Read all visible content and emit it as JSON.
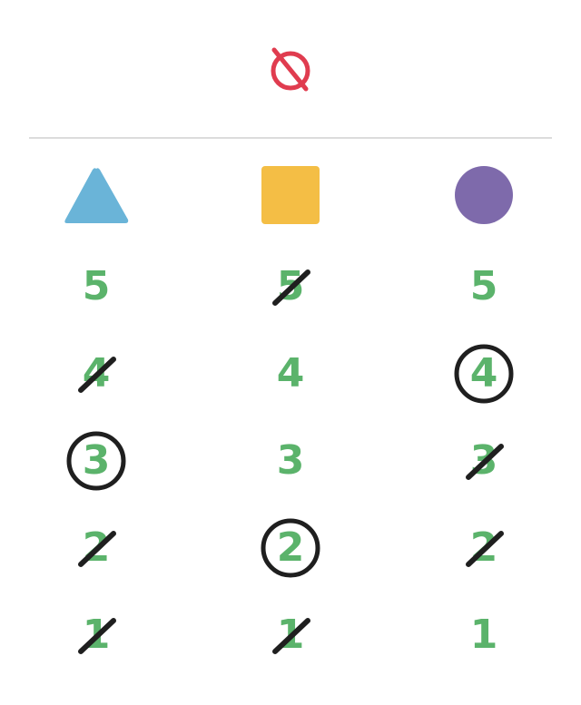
{
  "header": {
    "icon": "prohibited-icon",
    "icon_color": "#e03c4f"
  },
  "colors": {
    "number": "#5bb36b",
    "mark": "#1f1f1f",
    "divider": "#dcdcdc"
  },
  "columns": [
    {
      "shape": "triangle",
      "shape_color": "#6ab4d8",
      "numbers": [
        {
          "value": "5",
          "state": "plain"
        },
        {
          "value": "4",
          "state": "crossed"
        },
        {
          "value": "3",
          "state": "circled"
        },
        {
          "value": "2",
          "state": "crossed"
        },
        {
          "value": "1",
          "state": "crossed"
        }
      ]
    },
    {
      "shape": "square",
      "shape_color": "#f4be45",
      "numbers": [
        {
          "value": "5",
          "state": "crossed"
        },
        {
          "value": "4",
          "state": "plain"
        },
        {
          "value": "3",
          "state": "plain"
        },
        {
          "value": "2",
          "state": "circled"
        },
        {
          "value": "1",
          "state": "crossed"
        }
      ]
    },
    {
      "shape": "circle",
      "shape_color": "#7e6aab",
      "numbers": [
        {
          "value": "5",
          "state": "plain"
        },
        {
          "value": "4",
          "state": "circled"
        },
        {
          "value": "3",
          "state": "crossed"
        },
        {
          "value": "2",
          "state": "crossed"
        },
        {
          "value": "1",
          "state": "plain"
        }
      ]
    }
  ]
}
